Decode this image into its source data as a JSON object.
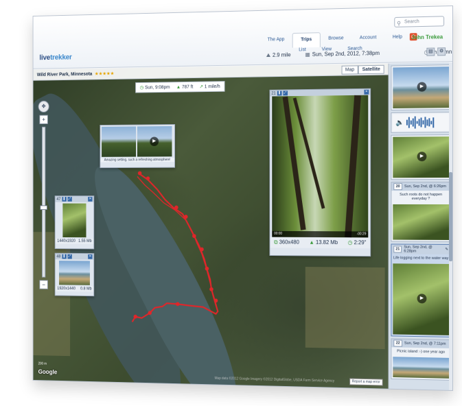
{
  "header": {
    "logo_prefix": "live",
    "logo_suffix": "trekker",
    "nav": [
      "The App",
      "Trips",
      "Browse",
      "Account",
      "Help"
    ],
    "nav_active": "Trips",
    "subnav": [
      "List",
      "View",
      "Search"
    ],
    "search_placeholder": "Search",
    "user_name": "John Trekea",
    "distance": "2.9 mile",
    "datetime": "Sun, Sep 2nd, 2012, 7:38pm",
    "duration": "1h 52mn"
  },
  "map": {
    "place_name": "Wild River Park, Minnesota",
    "rating_stars": "★★★★★",
    "stats": [
      "Sun, 9:08pm",
      "787 ft",
      "1 mile/h"
    ],
    "maptype": [
      "Map",
      "Satellite"
    ],
    "maptype_active": "Satellite",
    "zoom_in": "+",
    "zoom_out": "−",
    "google": "Google",
    "scale": "200 m",
    "copyright": "Map data ©2012 Google Imagery ©2012 DigitalGlobe, USDA Farm Service Agency",
    "report": "Report a map error"
  },
  "popups": {
    "caption_top": "Amazing setting, such a refreshing atmosphere!",
    "photo1": {
      "num": "47",
      "res": "1440x1920",
      "size": "1.55 Mb"
    },
    "photo2": {
      "num": "48",
      "res": "1920x1440",
      "size": "0.8 Mb"
    },
    "video": {
      "num": "21",
      "res": "360x480",
      "size": "13.82 Mb",
      "length": "2:29\"",
      "time_start": "00:00",
      "time_end": "-00:29"
    }
  },
  "sidebar": {
    "cards": [
      {
        "num": "",
        "date": "",
        "text": ""
      },
      {
        "num": "",
        "date": "",
        "text": "",
        "audio": true
      },
      {
        "num": "",
        "date": "",
        "text": ""
      },
      {
        "num": "20",
        "date": "Sun, Sep 2nd, @ 6:26pm",
        "text": "Such roots do not happen everyday ?"
      },
      {
        "num": "21",
        "date": "Sun, Sep 2nd, @ 6:28pm",
        "text": "Life logging next to the water way"
      },
      {
        "num": "22",
        "date": "Sun, Sep 2nd, @ 7:11pm",
        "text": "Picnic island :-) one year ago"
      }
    ]
  },
  "colors": {
    "route": "#e0262a",
    "accent": "#3468a8",
    "user": "#3a9a3a"
  }
}
